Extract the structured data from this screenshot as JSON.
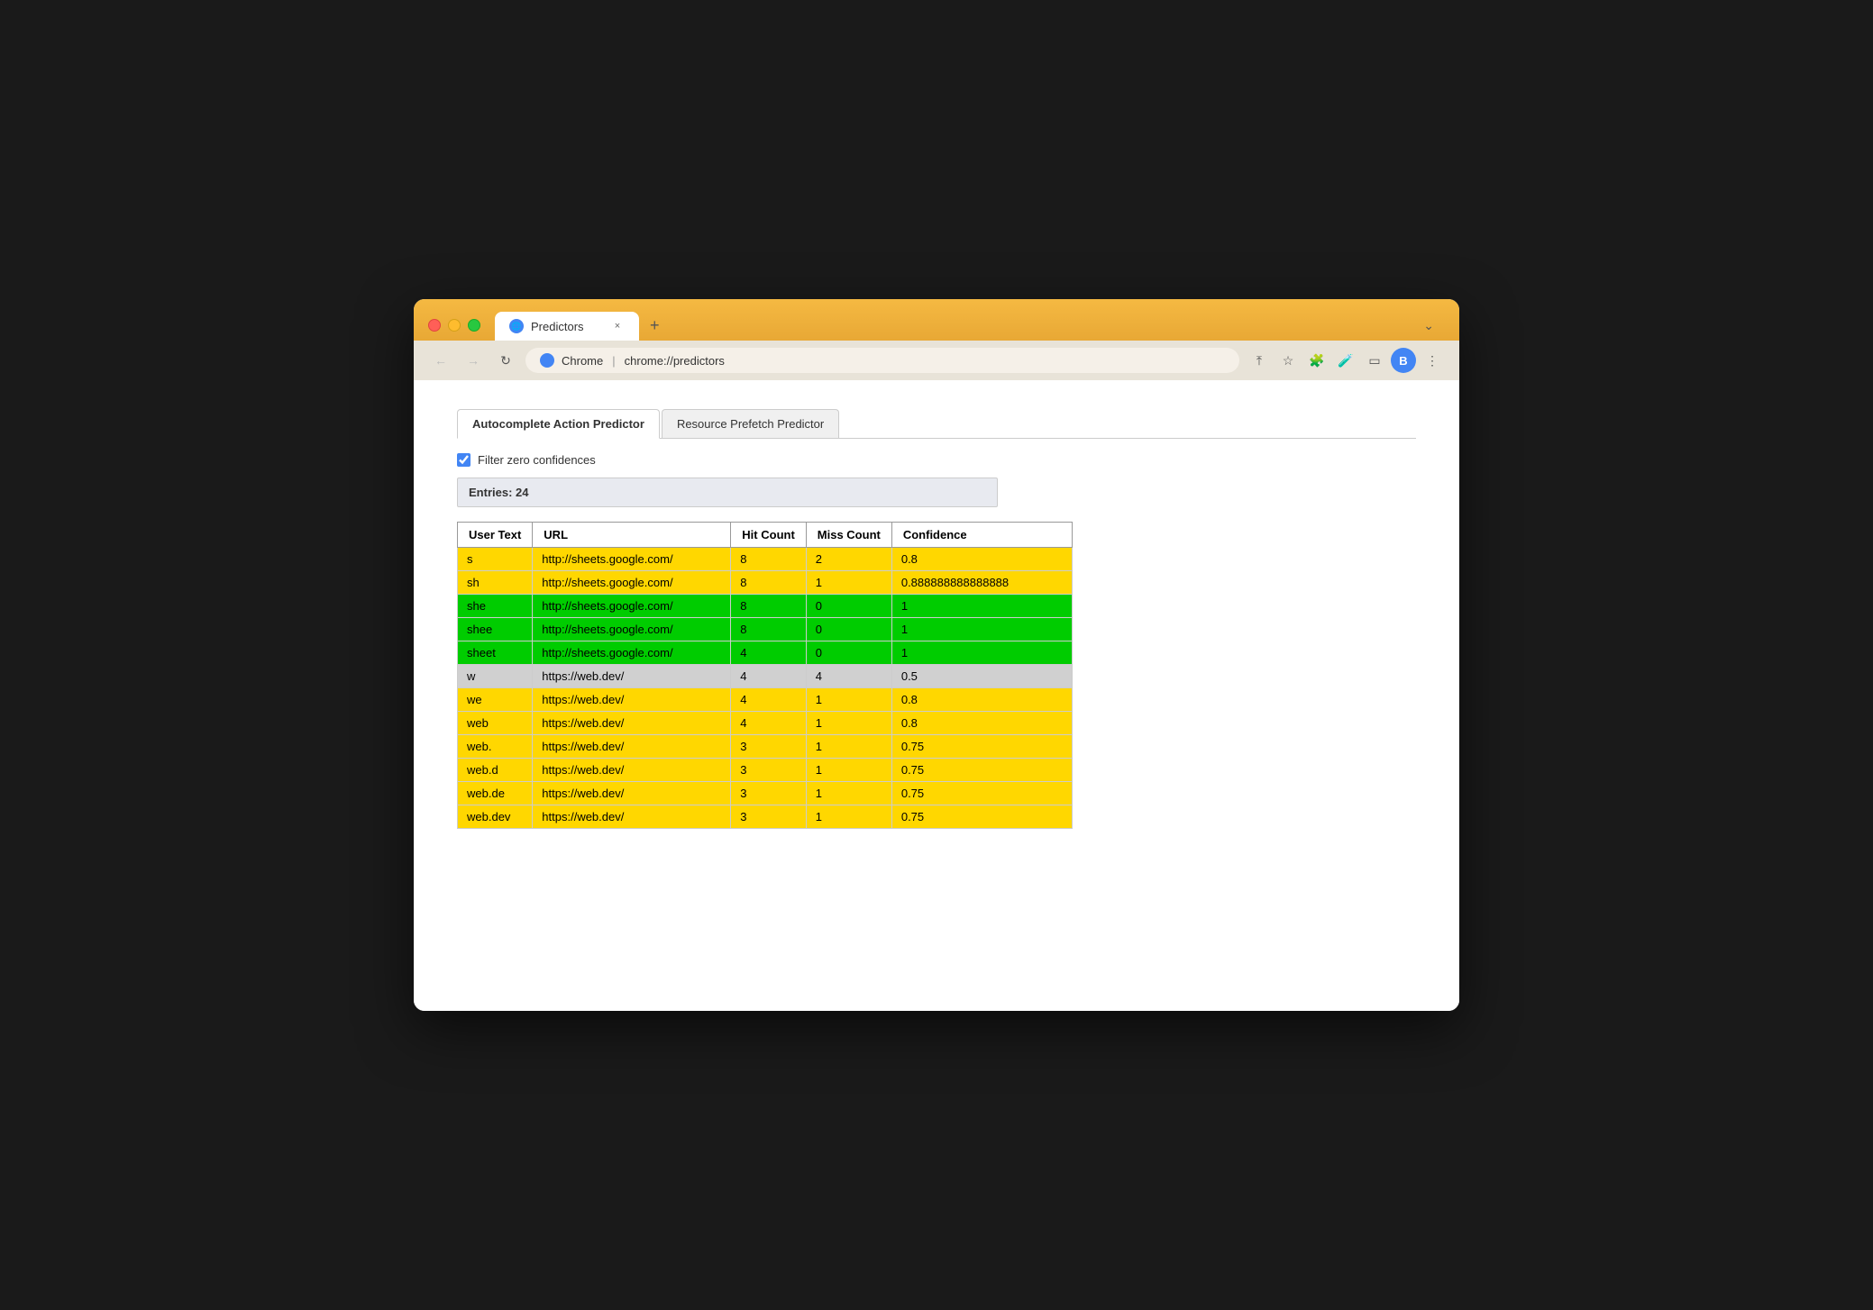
{
  "browser": {
    "tab_label": "Predictors",
    "tab_close": "×",
    "tab_new": "+",
    "tab_more": "⌄",
    "back_arrow": "←",
    "forward_arrow": "→",
    "reload": "↻",
    "chrome_label": "Chrome",
    "address_separator": "|",
    "address_url": "chrome://predictors",
    "toolbar_icons": [
      "⤒",
      "☆",
      "🧩",
      "🧪",
      "▭",
      "⋮"
    ],
    "profile_initial": "B"
  },
  "page": {
    "tabs": [
      {
        "label": "Autocomplete Action Predictor",
        "active": true
      },
      {
        "label": "Resource Prefetch Predictor",
        "active": false
      }
    ],
    "filter_label": "Filter zero confidences",
    "filter_checked": true,
    "entries_label": "Entries: 24",
    "table": {
      "headers": [
        "User Text",
        "URL",
        "Hit Count",
        "Miss Count",
        "Confidence"
      ],
      "rows": [
        {
          "user_text": "s",
          "url": "http://sheets.google.com/",
          "hit_count": "8",
          "miss_count": "2",
          "confidence": "0.8",
          "color": "yellow"
        },
        {
          "user_text": "sh",
          "url": "http://sheets.google.com/",
          "hit_count": "8",
          "miss_count": "1",
          "confidence": "0.888888888888888",
          "color": "yellow"
        },
        {
          "user_text": "she",
          "url": "http://sheets.google.com/",
          "hit_count": "8",
          "miss_count": "0",
          "confidence": "1",
          "color": "green"
        },
        {
          "user_text": "shee",
          "url": "http://sheets.google.com/",
          "hit_count": "8",
          "miss_count": "0",
          "confidence": "1",
          "color": "green"
        },
        {
          "user_text": "sheet",
          "url": "http://sheets.google.com/",
          "hit_count": "4",
          "miss_count": "0",
          "confidence": "1",
          "color": "green"
        },
        {
          "user_text": "w",
          "url": "https://web.dev/",
          "hit_count": "4",
          "miss_count": "4",
          "confidence": "0.5",
          "color": "grey"
        },
        {
          "user_text": "we",
          "url": "https://web.dev/",
          "hit_count": "4",
          "miss_count": "1",
          "confidence": "0.8",
          "color": "yellow"
        },
        {
          "user_text": "web",
          "url": "https://web.dev/",
          "hit_count": "4",
          "miss_count": "1",
          "confidence": "0.8",
          "color": "yellow"
        },
        {
          "user_text": "web.",
          "url": "https://web.dev/",
          "hit_count": "3",
          "miss_count": "1",
          "confidence": "0.75",
          "color": "yellow"
        },
        {
          "user_text": "web.d",
          "url": "https://web.dev/",
          "hit_count": "3",
          "miss_count": "1",
          "confidence": "0.75",
          "color": "yellow"
        },
        {
          "user_text": "web.de",
          "url": "https://web.dev/",
          "hit_count": "3",
          "miss_count": "1",
          "confidence": "0.75",
          "color": "yellow"
        },
        {
          "user_text": "web.dev",
          "url": "https://web.dev/",
          "hit_count": "3",
          "miss_count": "1",
          "confidence": "0.75",
          "color": "yellow"
        }
      ]
    }
  }
}
